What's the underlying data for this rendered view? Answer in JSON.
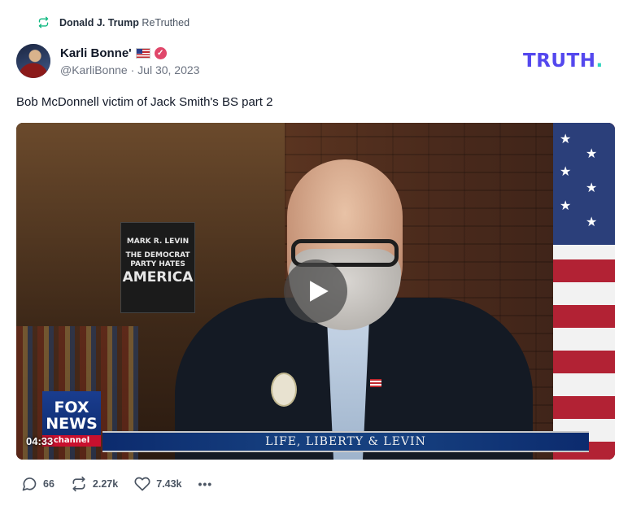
{
  "retruth": {
    "author": "Donald J. Trump",
    "label": "ReTruthed"
  },
  "post": {
    "display_name": "Karli Bonne'",
    "handle": "@KarliBonne",
    "date": "Jul 30, 2023",
    "text": "Bob McDonnell victim of Jack Smith's BS part 2"
  },
  "logo": {
    "text": "TRUTH",
    "dot": ".",
    "color": "#5448ee",
    "dot_color": "#2dd4bf"
  },
  "video": {
    "duration": "04:33",
    "lower_third": "LIFE, LIBERTY & LEVIN",
    "network": {
      "line1": "FOX",
      "line2": "NEWS",
      "line3": "channel"
    },
    "book": {
      "author": "MARK R. LEVIN",
      "title_top": "THE DEMOCRAT PARTY HATES",
      "title_big": "AMERICA"
    }
  },
  "actions": {
    "replies": "66",
    "retruths": "2.27k",
    "likes": "7.43k",
    "more": "•••"
  },
  "icons": [
    "retruth-icon",
    "verified-icon",
    "play-icon",
    "reply-icon",
    "retruth-action-icon",
    "like-icon",
    "more-icon"
  ]
}
